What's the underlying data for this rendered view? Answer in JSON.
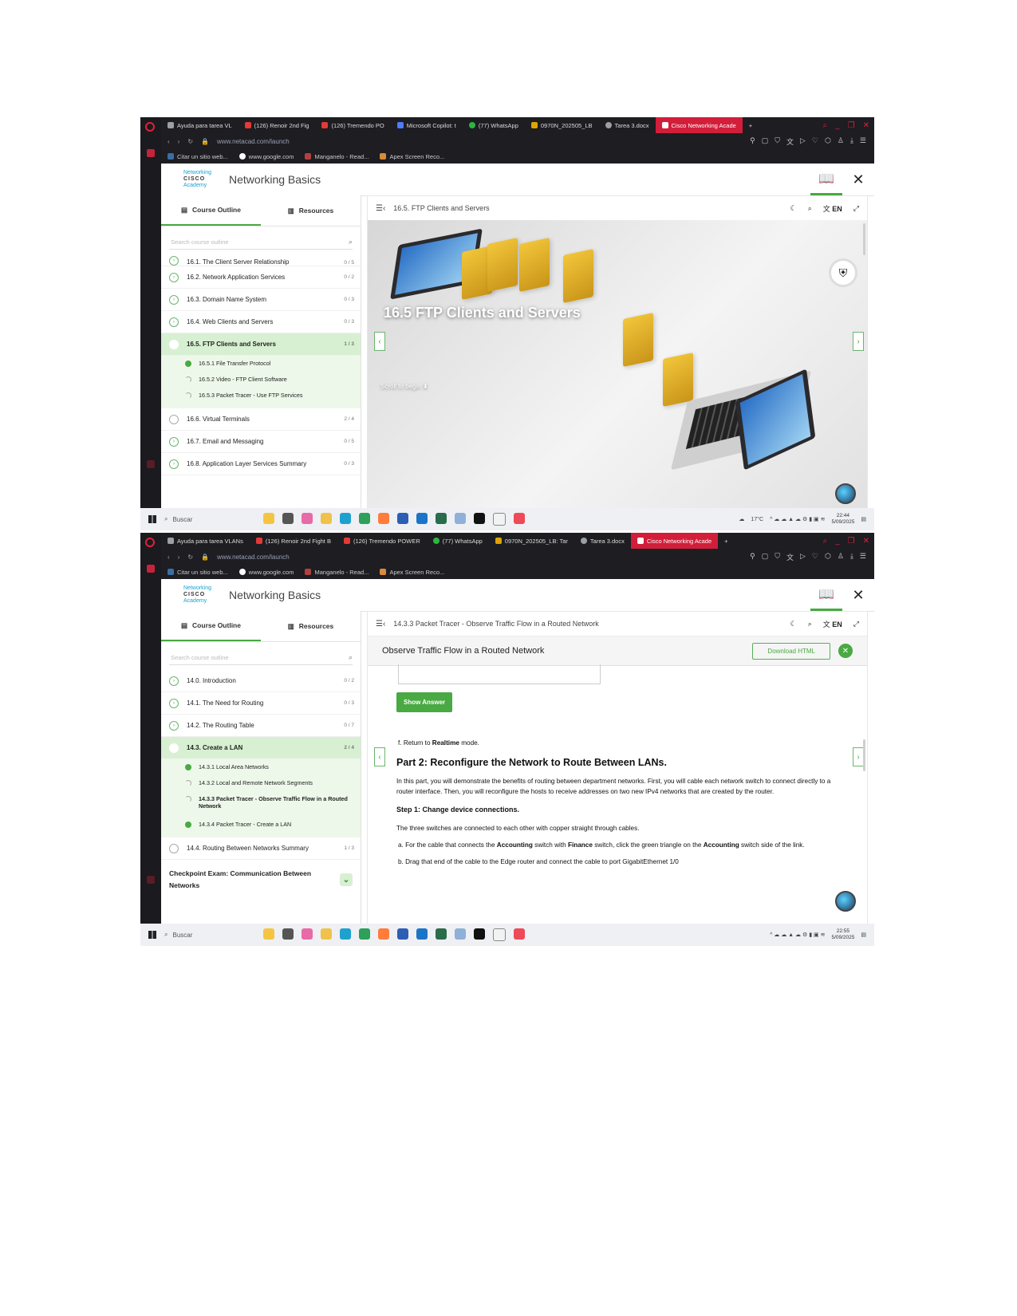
{
  "screenshots": [
    {
      "browser": {
        "tabs": [
          {
            "label": "Ayuda para tarea VL",
            "color": "#9aa0a6"
          },
          {
            "label": "(126) Renoir 2nd Fig",
            "color": "#e53935"
          },
          {
            "label": "(126) Tremendo PO",
            "color": "#e53935"
          },
          {
            "label": "Microsoft Copilot: t",
            "color": "#4f7cff"
          },
          {
            "label": "(77) WhatsApp",
            "color": "#2bb741"
          },
          {
            "label": "0970N_202505_LB",
            "color": "#e0a400"
          },
          {
            "label": "Tarea 3.docx",
            "color": "#9aa0a6"
          },
          {
            "label": "Cisco Networking Acade",
            "color": "#ffffff",
            "active": true
          }
        ],
        "url": "www.netacad.com/launch",
        "bookmarks": [
          "Citar un sitio web...",
          "www.google.com",
          "Manganelo - Read...",
          "Apex Screen Reco..."
        ]
      },
      "app": {
        "logo_line1": "Networking",
        "logo_line2": "Academy",
        "logo_brand": "CISCO",
        "course_title": "Networking Basics",
        "sidebar": {
          "tab_outline": "Course Outline",
          "tab_resources": "Resources",
          "search_placeholder": "Search course outline",
          "items": [
            {
              "label": "16.1. The Client Server Relationship",
              "progress": "0 / 5"
            },
            {
              "label": "16.2. Network Application Services",
              "progress": "0 / 2"
            },
            {
              "label": "16.3. Domain Name System",
              "progress": "0 / 3"
            },
            {
              "label": "16.4. Web Clients and Servers",
              "progress": "0 / 3"
            },
            {
              "label": "16.5. FTP Clients and Servers",
              "progress": "1 / 3",
              "active": true
            },
            {
              "label": "16.6. Virtual Terminals",
              "progress": "2 / 4"
            },
            {
              "label": "16.7. Email and Messaging",
              "progress": "0 / 5"
            },
            {
              "label": "16.8. Application Layer Services Summary",
              "progress": "0 / 3"
            }
          ],
          "subitems": [
            {
              "label": "16.5.1 File Transfer Protocol",
              "status": "done"
            },
            {
              "label": "16.5.2 Video - FTP Client Software",
              "status": "partial"
            },
            {
              "label": "16.5.3 Packet Tracer - Use FTP Services",
              "status": "partial"
            }
          ]
        },
        "content": {
          "toolbar_title": "16.5. FTP Clients and Servers",
          "lang": "EN",
          "hero_title": "16.5 FTP Clients and Servers",
          "hero_scroll": "Scroll to begin"
        }
      },
      "taskbar": {
        "search": "Buscar",
        "temp": "17°C",
        "time": "22:44",
        "date": "5/09/2025"
      }
    },
    {
      "browser": {
        "tabs": [
          {
            "label": "Ayuda para tarea VLANs",
            "color": "#9aa0a6"
          },
          {
            "label": "(126) Renoir 2nd Fight B",
            "color": "#e53935"
          },
          {
            "label": "(126) Tremendo POWER",
            "color": "#e53935"
          },
          {
            "label": "(77) WhatsApp",
            "color": "#2bb741"
          },
          {
            "label": "0970N_202505_LB: Tar",
            "color": "#e0a400"
          },
          {
            "label": "Tarea 3.docx",
            "color": "#9aa0a6"
          },
          {
            "label": "Cisco Networking Acade",
            "color": "#ffffff",
            "active": true
          }
        ],
        "url": "www.netacad.com/launch",
        "bookmarks": [
          "Citar un sitio web...",
          "www.google.com",
          "Manganelo - Read...",
          "Apex Screen Reco..."
        ]
      },
      "app": {
        "logo_line1": "Networking",
        "logo_line2": "Academy",
        "logo_brand": "CISCO",
        "course_title": "Networking Basics",
        "sidebar": {
          "tab_outline": "Course Outline",
          "tab_resources": "Resources",
          "search_placeholder": "Search course outline",
          "items": [
            {
              "label": "14.0. Introduction",
              "progress": "0 / 2"
            },
            {
              "label": "14.1. The Need for Routing",
              "progress": "0 / 3"
            },
            {
              "label": "14.2. The Routing Table",
              "progress": "0 / 7"
            },
            {
              "label": "14.3. Create a LAN",
              "progress": "2 / 4",
              "active": true
            },
            {
              "label": "14.4. Routing Between Networks Summary",
              "progress": "1 / 3"
            }
          ],
          "subitems": [
            {
              "label": "14.3.1 Local Area Networks",
              "status": "done"
            },
            {
              "label": "14.3.2 Local and Remote Network Segments",
              "status": "partial"
            },
            {
              "label": "14.3.3 Packet Tracer - Observe Traffic Flow in a Routed Network",
              "status": "partial",
              "bold": true
            },
            {
              "label": "14.3.4 Packet Tracer - Create a LAN",
              "status": "done"
            }
          ],
          "checkpoint": "Checkpoint Exam: Communication Between Networks"
        },
        "content": {
          "toolbar_title": "14.3.3 Packet Tracer - Observe Traffic Flow in a Routed Network",
          "lang": "EN",
          "activity_title": "Observe Traffic Flow in a Routed Network",
          "download_label": "Download HTML",
          "show_answer": "Show Answer",
          "step_f_prefix": "f.   Return to ",
          "step_f_bold": "Realtime",
          "step_f_suffix": " mode.",
          "part2_heading": "Part 2: Reconfigure the Network to Route Between LANs.",
          "part2_text": "In this part, you will demonstrate the benefits of routing between department networks. First, you will cable each network switch to connect directly to a router interface. Then, you will reconfigure the hosts to receive addresses on two new IPv4 networks that are created by the router.",
          "step1_heading": "Step 1: Change device connections.",
          "step1_text": "The three switches are connected to each other with copper straight through cables.",
          "item_a_prefix": "a.   For the cable that connects the ",
          "item_a_b1": "Accounting",
          "item_a_mid": " switch with ",
          "item_a_b2": "Finance",
          "item_a_mid2": " switch, click the green triangle on the ",
          "item_a_b3": "Accounting",
          "item_a_suffix": " switch side of the link.",
          "item_b": "b.   Drag that end of the cable to the Edge router and connect the cable to port GigabitEthernet 1/0"
        }
      },
      "taskbar": {
        "search": "Buscar",
        "temp": "",
        "time": "22:55",
        "date": "5/09/2025"
      }
    }
  ]
}
